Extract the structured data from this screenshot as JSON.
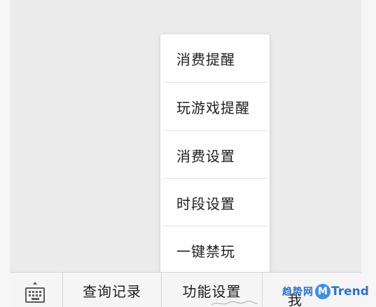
{
  "popup_menu": {
    "items": [
      {
        "label": "消费提醒"
      },
      {
        "label": "玩游戏提醒"
      },
      {
        "label": "消费设置"
      },
      {
        "label": "时段设置"
      },
      {
        "label": "一键禁玩"
      }
    ]
  },
  "bottom_bar": {
    "keyboard_icon": "keyboard-icon",
    "tabs": [
      {
        "label": "查询记录"
      },
      {
        "label": "功能设置"
      },
      {
        "label": "我"
      }
    ]
  },
  "watermark": {
    "cn_text": "趋势网",
    "logo_letter": "M",
    "en_text": "Trend"
  },
  "colors": {
    "background": "#ebebeb",
    "menu_background": "#fefefe",
    "text": "#1e1e1e",
    "watermark_blue": "#2d72c8"
  }
}
